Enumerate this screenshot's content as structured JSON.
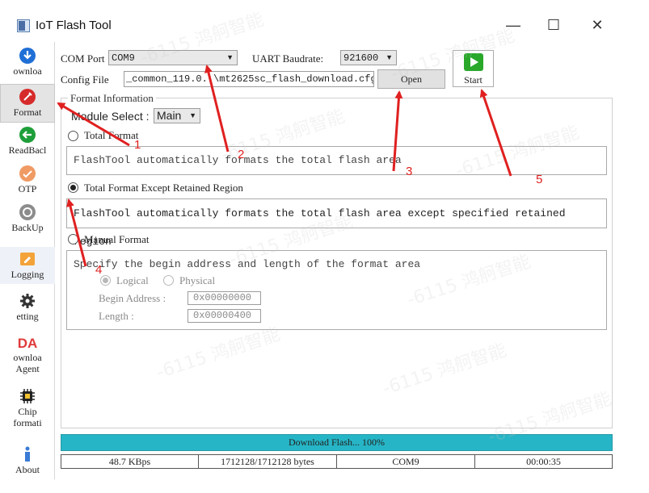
{
  "window": {
    "title": "IoT Flash Tool",
    "minimize": "—",
    "maximize": "☐",
    "close": "✕"
  },
  "sidebar": {
    "items": [
      {
        "label": "ownloa",
        "icon": "download-icon"
      },
      {
        "label": "Format",
        "icon": "format-icon"
      },
      {
        "label": "ReadBacl",
        "icon": "readback-icon"
      },
      {
        "label": "OTP",
        "icon": "otp-icon"
      },
      {
        "label": "BackUp",
        "icon": "backup-icon"
      },
      {
        "label": "Logging",
        "icon": "logging-icon"
      },
      {
        "label": "etting",
        "icon": "gear-icon"
      },
      {
        "label": "DA",
        "label2": "ownloa",
        "label3": "Agent",
        "icon": "da-icon"
      },
      {
        "label": "Chip",
        "label2": "formati",
        "icon": "chip-icon"
      },
      {
        "label": "About",
        "icon": "info-icon"
      }
    ]
  },
  "config": {
    "com_port_label": "COM Port",
    "com_port_value": "COM9",
    "baud_label": "UART Baudrate:",
    "baud_value": "921600",
    "config_file_label": "Config File",
    "config_file_value": "_common_119.0.   \\mt2625sc_flash_download.cfg",
    "open_label": "Open",
    "start_label": "Start"
  },
  "format": {
    "group_title": "Format Information",
    "module_select_label": "Module Select :",
    "module_select_value": "Main",
    "options": [
      {
        "label": "Total Format",
        "desc": "FlashTool automatically formats the total flash area",
        "selected": false
      },
      {
        "label": "Total Format Except Retained Region",
        "desc": "FlashTool automatically formats the total flash area except specified retained region",
        "selected": true
      },
      {
        "label": "Manual Format",
        "desc": "Specify the begin address and length of the format area",
        "selected": false
      }
    ],
    "manual": {
      "logical": "Logical",
      "physical": "Physical",
      "begin_label": "Begin Address :",
      "begin_value": "0x00000000",
      "length_label": "Length :",
      "length_value": "0x00000400"
    }
  },
  "progress": {
    "text": "Download Flash... 100%",
    "fraction": 1.0
  },
  "status": {
    "speed": "48.7 KBps",
    "bytes": "1712128/1712128 bytes",
    "port": "COM9",
    "time": "00:00:35"
  },
  "annotations": {
    "n1": "1",
    "n2": "2",
    "n3": "3",
    "n4": "4",
    "n5": "5",
    "color": "#e02020"
  },
  "watermark": {
    "text": "-6115 鸿舸智能"
  }
}
